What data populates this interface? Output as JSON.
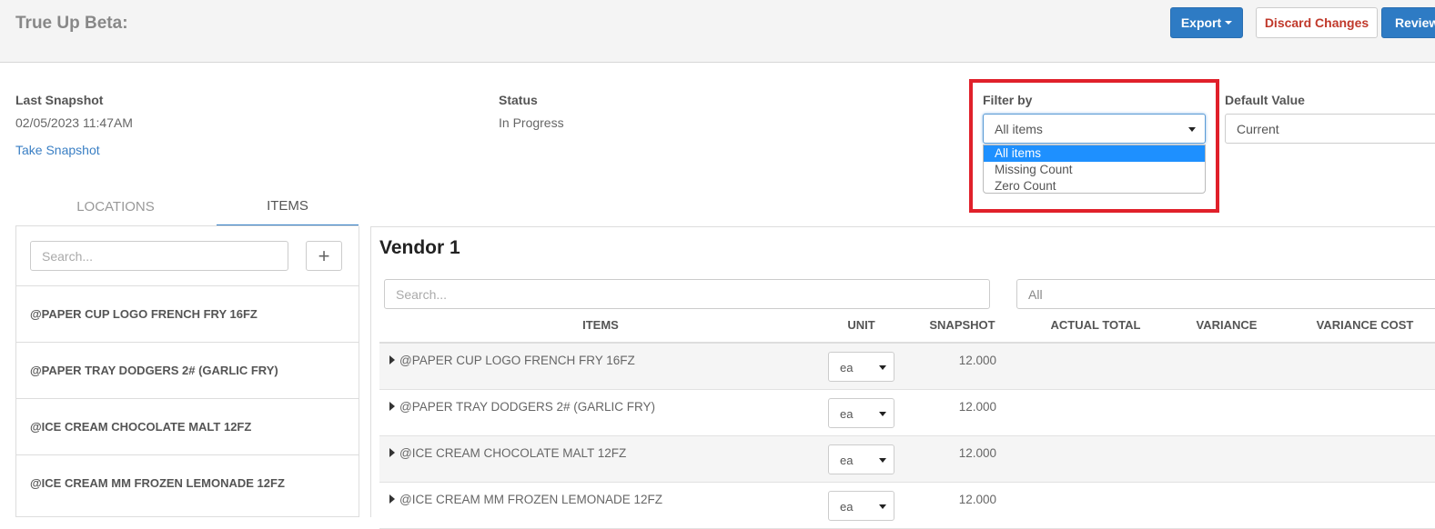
{
  "header": {
    "title": "True Up Beta:",
    "export_label": "Export",
    "discard_label": "Discard Changes",
    "review_label": "Review"
  },
  "info": {
    "last_snapshot_label": "Last Snapshot",
    "last_snapshot_value": "02/05/2023 11:47AM",
    "take_snapshot_link": "Take Snapshot",
    "status_label": "Status",
    "status_value": "In Progress",
    "filter_label": "Filter by",
    "filter_value": "All items",
    "filter_options": [
      "All items",
      "Missing Count",
      "Zero Count"
    ],
    "default_label": "Default Value",
    "default_value": "Current"
  },
  "tabs": [
    {
      "label": "LOCATIONS",
      "active": false
    },
    {
      "label": "ITEMS",
      "active": true
    }
  ],
  "left": {
    "search_placeholder": "Search...",
    "add_icon": "plus-icon",
    "items": [
      "@PAPER CUP LOGO FRENCH FRY 16FZ",
      "@PAPER TRAY DODGERS 2# (GARLIC FRY)",
      "@ICE CREAM CHOCOLATE MALT 12FZ",
      "@ICE CREAM MM FROZEN LEMONADE 12FZ"
    ]
  },
  "main": {
    "vendor_title": "Vendor 1",
    "search_placeholder": "Search...",
    "category_value": "All",
    "columns": [
      "ITEMS",
      "UNIT",
      "SNAPSHOT",
      "ACTUAL TOTAL",
      "VARIANCE",
      "VARIANCE COST"
    ],
    "rows": [
      {
        "name": "@PAPER CUP LOGO FRENCH FRY 16FZ",
        "unit": "ea",
        "snapshot": "12.000"
      },
      {
        "name": "@PAPER TRAY DODGERS 2# (GARLIC FRY)",
        "unit": "ea",
        "snapshot": "12.000"
      },
      {
        "name": "@ICE CREAM CHOCOLATE MALT 12FZ",
        "unit": "ea",
        "snapshot": "12.000"
      },
      {
        "name": "@ICE CREAM MM FROZEN LEMONADE 12FZ",
        "unit": "ea",
        "snapshot": "12.000"
      }
    ]
  },
  "colors": {
    "primary": "#2e7bc4",
    "danger_text": "#c0392b",
    "highlight_border": "#e0202a",
    "selected_option": "#1e90ff"
  }
}
